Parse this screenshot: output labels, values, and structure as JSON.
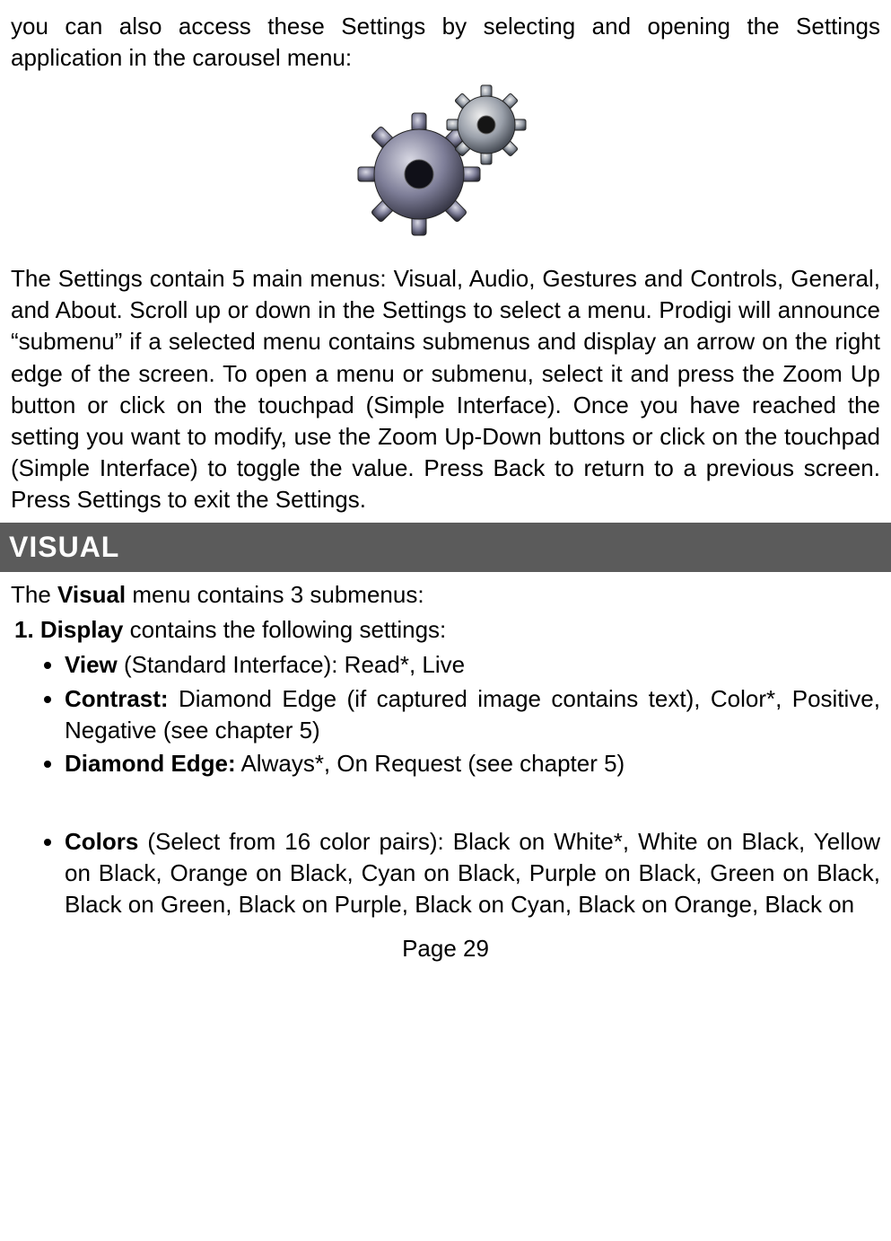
{
  "intro_top": "you can also access these Settings by selecting and opening the Settings application in the carousel menu:",
  "main_para": "The Settings contain 5 main menus: Visual, Audio, Gestures and Controls, General, and About. Scroll up or down in the Settings to select a menu. Prodigi will announce “submenu” if a selected menu contains submenus and display an arrow on the right edge of the screen. To open a menu or submenu, select it and press the Zoom Up button or click on the touchpad (Simple Interface). Once you have reached the setting you want to modify, use the Zoom Up-Down buttons or click on the touchpad (Simple Interface) to toggle the value. Press Back to return to a previous screen. Press Settings to exit the Settings.",
  "section_title": "VISUAL",
  "visual_intro_pre": "The ",
  "visual_intro_bold": "Visual",
  "visual_intro_post": " menu contains 3 submenus:",
  "display_num_bold": "1. Display",
  "display_num_post": " contains the following settings:",
  "bullets_a": {
    "view_bold": "View",
    "view_rest": " (Standard Interface): Read*, Live",
    "contrast_bold": "Contrast:",
    "contrast_rest": " Diamond Edge (if captured image contains text), Color*, Positive, Negative (see chapter 5)",
    "de_bold": "Diamond Edge:",
    "de_rest": " Always*, On Request (see chapter 5)"
  },
  "bullets_b": {
    "colors_bold": "Colors",
    "colors_rest": " (Select from 16 color pairs): Black on White*, White on Black, Yellow on Black, Orange on Black, Cyan on Black, Purple on Black, Green on Black, Black on Green, Black on Purple, Black on Cyan, Black on Orange, Black on"
  },
  "page_number": "Page 29"
}
